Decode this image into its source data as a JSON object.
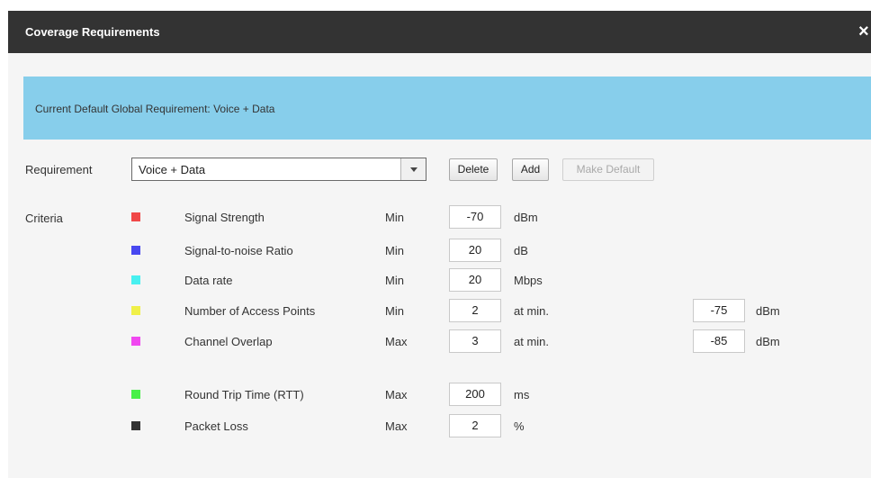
{
  "dialog": {
    "title": "Coverage Requirements",
    "close_icon": "×",
    "banner_text": "Current Default Global Requirement:   Voice + Data",
    "banner_color": "#87ceeb"
  },
  "requirement": {
    "label": "Requirement",
    "selected": "Voice + Data",
    "buttons": {
      "delete": "Delete",
      "add": "Add",
      "make_default": "Make Default"
    }
  },
  "criteria": {
    "label": "Criteria",
    "rows": [
      {
        "color": "#f04848",
        "name": "Signal Strength",
        "mode": "Min",
        "value": "-70",
        "unit": "dBm"
      },
      {
        "color": "#4848f0",
        "name": "Signal-to-noise Ratio",
        "mode": "Min",
        "value": "20",
        "unit": "dB"
      },
      {
        "color": "#48f0f0",
        "name": "Data rate",
        "mode": "Min",
        "value": "20",
        "unit": "Mbps"
      },
      {
        "color": "#f0f048",
        "name": "Number of Access Points",
        "mode": "Min",
        "value": "2",
        "unit": "at min.",
        "extra_value": "-75",
        "extra_unit": "dBm"
      },
      {
        "color": "#f048f0",
        "name": "Channel Overlap",
        "mode": "Max",
        "value": "3",
        "unit": "at min.",
        "extra_value": "-85",
        "extra_unit": "dBm"
      },
      {
        "color": "#48f048",
        "name": "Round Trip Time (RTT)",
        "mode": "Max",
        "value": "200",
        "unit": "ms"
      },
      {
        "color": "#333333",
        "name": "Packet Loss",
        "mode": "Max",
        "value": "2",
        "unit": "%"
      }
    ]
  }
}
